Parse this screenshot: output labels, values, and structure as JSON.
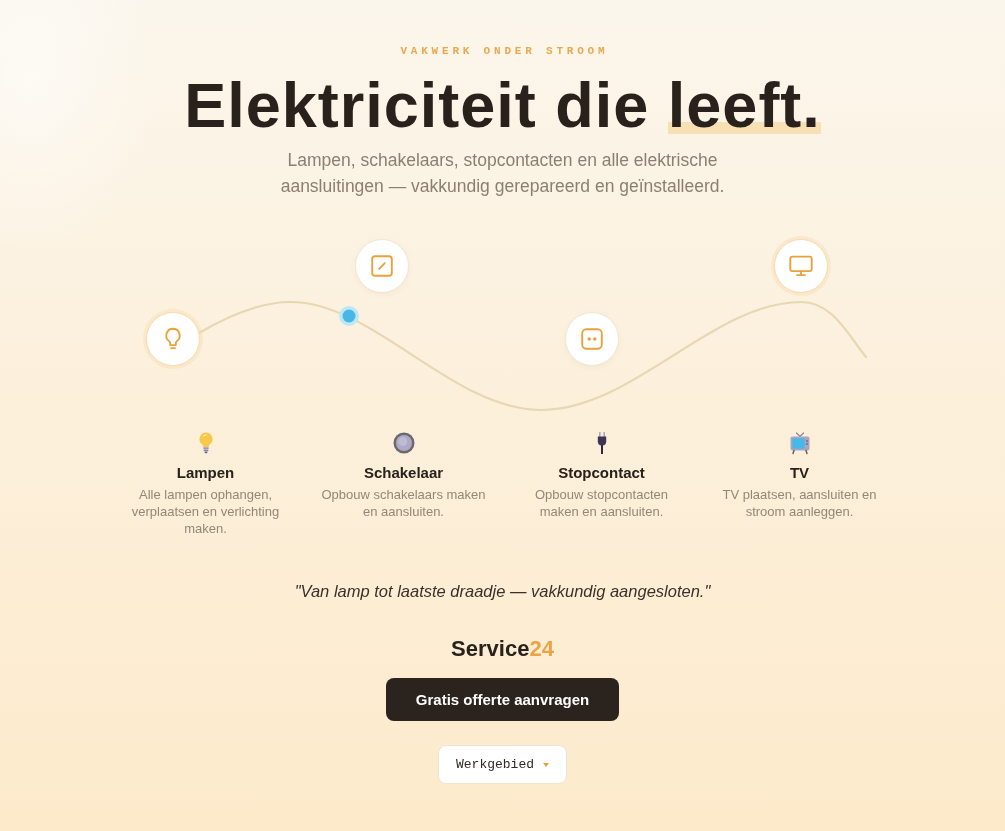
{
  "hero": {
    "eyebrow": "VAKWERK ONDER STROOM",
    "headline": {
      "text": "Elektriciteit die",
      "highlight": "leeft."
    },
    "subtitle": "Lampen, schakelaars, stopcontacten en alle elektrische aansluitingen — vakkundig gerepareerd en geïnstalleerd."
  },
  "services": [
    {
      "kind": "lamp",
      "glow": true,
      "title": "Lampen",
      "description": "Alle lampen ophangen, verplaatsen en verlichting maken."
    },
    {
      "kind": "switch",
      "glow": false,
      "title": "Schakelaar",
      "description": "Opbouw schakelaars maken en aansluiten."
    },
    {
      "kind": "socket",
      "glow": false,
      "title": "Stopcontact",
      "description": "Opbouw stopcontacten maken en aansluiten."
    },
    {
      "kind": "tv",
      "glow": true,
      "title": "TV",
      "description": "TV plaatsen, aansluiten en stroom aanleggen."
    }
  ],
  "quote": "\"Van lamp tot laatste draadje — vakkundig aangesloten.\"",
  "brand": {
    "name": "Service",
    "accent": "24"
  },
  "cta_button": "Gratis offerte aanvragen",
  "area_dropdown": {
    "label": "Werkgebied"
  }
}
